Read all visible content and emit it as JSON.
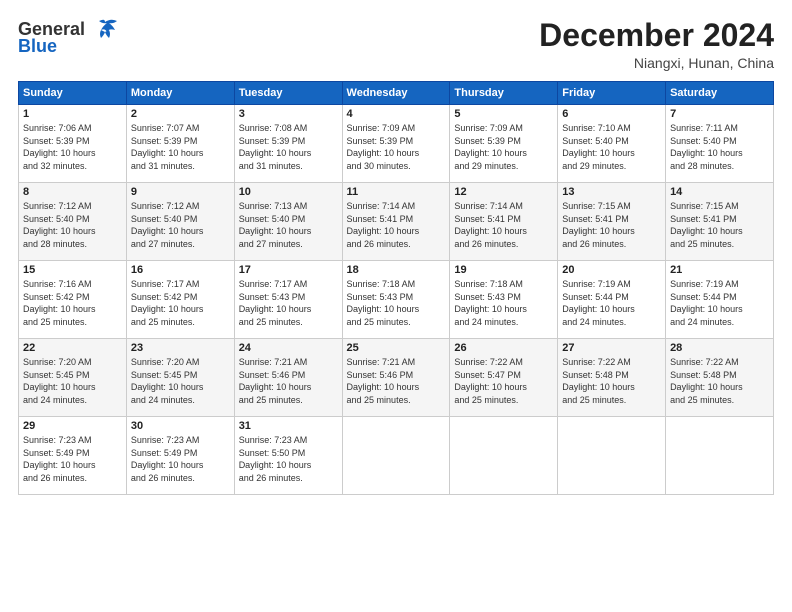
{
  "logo": {
    "line1": "General",
    "line2": "Blue"
  },
  "header": {
    "month": "December 2024",
    "location": "Niangxi, Hunan, China"
  },
  "days_of_week": [
    "Sunday",
    "Monday",
    "Tuesday",
    "Wednesday",
    "Thursday",
    "Friday",
    "Saturday"
  ],
  "weeks": [
    [
      {
        "day": "1",
        "info": "Sunrise: 7:06 AM\nSunset: 5:39 PM\nDaylight: 10 hours\nand 32 minutes."
      },
      {
        "day": "2",
        "info": "Sunrise: 7:07 AM\nSunset: 5:39 PM\nDaylight: 10 hours\nand 31 minutes."
      },
      {
        "day": "3",
        "info": "Sunrise: 7:08 AM\nSunset: 5:39 PM\nDaylight: 10 hours\nand 31 minutes."
      },
      {
        "day": "4",
        "info": "Sunrise: 7:09 AM\nSunset: 5:39 PM\nDaylight: 10 hours\nand 30 minutes."
      },
      {
        "day": "5",
        "info": "Sunrise: 7:09 AM\nSunset: 5:39 PM\nDaylight: 10 hours\nand 29 minutes."
      },
      {
        "day": "6",
        "info": "Sunrise: 7:10 AM\nSunset: 5:40 PM\nDaylight: 10 hours\nand 29 minutes."
      },
      {
        "day": "7",
        "info": "Sunrise: 7:11 AM\nSunset: 5:40 PM\nDaylight: 10 hours\nand 28 minutes."
      }
    ],
    [
      {
        "day": "8",
        "info": "Sunrise: 7:12 AM\nSunset: 5:40 PM\nDaylight: 10 hours\nand 28 minutes."
      },
      {
        "day": "9",
        "info": "Sunrise: 7:12 AM\nSunset: 5:40 PM\nDaylight: 10 hours\nand 27 minutes."
      },
      {
        "day": "10",
        "info": "Sunrise: 7:13 AM\nSunset: 5:40 PM\nDaylight: 10 hours\nand 27 minutes."
      },
      {
        "day": "11",
        "info": "Sunrise: 7:14 AM\nSunset: 5:41 PM\nDaylight: 10 hours\nand 26 minutes."
      },
      {
        "day": "12",
        "info": "Sunrise: 7:14 AM\nSunset: 5:41 PM\nDaylight: 10 hours\nand 26 minutes."
      },
      {
        "day": "13",
        "info": "Sunrise: 7:15 AM\nSunset: 5:41 PM\nDaylight: 10 hours\nand 26 minutes."
      },
      {
        "day": "14",
        "info": "Sunrise: 7:15 AM\nSunset: 5:41 PM\nDaylight: 10 hours\nand 25 minutes."
      }
    ],
    [
      {
        "day": "15",
        "info": "Sunrise: 7:16 AM\nSunset: 5:42 PM\nDaylight: 10 hours\nand 25 minutes."
      },
      {
        "day": "16",
        "info": "Sunrise: 7:17 AM\nSunset: 5:42 PM\nDaylight: 10 hours\nand 25 minutes."
      },
      {
        "day": "17",
        "info": "Sunrise: 7:17 AM\nSunset: 5:43 PM\nDaylight: 10 hours\nand 25 minutes."
      },
      {
        "day": "18",
        "info": "Sunrise: 7:18 AM\nSunset: 5:43 PM\nDaylight: 10 hours\nand 25 minutes."
      },
      {
        "day": "19",
        "info": "Sunrise: 7:18 AM\nSunset: 5:43 PM\nDaylight: 10 hours\nand 24 minutes."
      },
      {
        "day": "20",
        "info": "Sunrise: 7:19 AM\nSunset: 5:44 PM\nDaylight: 10 hours\nand 24 minutes."
      },
      {
        "day": "21",
        "info": "Sunrise: 7:19 AM\nSunset: 5:44 PM\nDaylight: 10 hours\nand 24 minutes."
      }
    ],
    [
      {
        "day": "22",
        "info": "Sunrise: 7:20 AM\nSunset: 5:45 PM\nDaylight: 10 hours\nand 24 minutes."
      },
      {
        "day": "23",
        "info": "Sunrise: 7:20 AM\nSunset: 5:45 PM\nDaylight: 10 hours\nand 24 minutes."
      },
      {
        "day": "24",
        "info": "Sunrise: 7:21 AM\nSunset: 5:46 PM\nDaylight: 10 hours\nand 25 minutes."
      },
      {
        "day": "25",
        "info": "Sunrise: 7:21 AM\nSunset: 5:46 PM\nDaylight: 10 hours\nand 25 minutes."
      },
      {
        "day": "26",
        "info": "Sunrise: 7:22 AM\nSunset: 5:47 PM\nDaylight: 10 hours\nand 25 minutes."
      },
      {
        "day": "27",
        "info": "Sunrise: 7:22 AM\nSunset: 5:48 PM\nDaylight: 10 hours\nand 25 minutes."
      },
      {
        "day": "28",
        "info": "Sunrise: 7:22 AM\nSunset: 5:48 PM\nDaylight: 10 hours\nand 25 minutes."
      }
    ],
    [
      {
        "day": "29",
        "info": "Sunrise: 7:23 AM\nSunset: 5:49 PM\nDaylight: 10 hours\nand 26 minutes."
      },
      {
        "day": "30",
        "info": "Sunrise: 7:23 AM\nSunset: 5:49 PM\nDaylight: 10 hours\nand 26 minutes."
      },
      {
        "day": "31",
        "info": "Sunrise: 7:23 AM\nSunset: 5:50 PM\nDaylight: 10 hours\nand 26 minutes."
      },
      {
        "day": "",
        "info": ""
      },
      {
        "day": "",
        "info": ""
      },
      {
        "day": "",
        "info": ""
      },
      {
        "day": "",
        "info": ""
      }
    ]
  ]
}
